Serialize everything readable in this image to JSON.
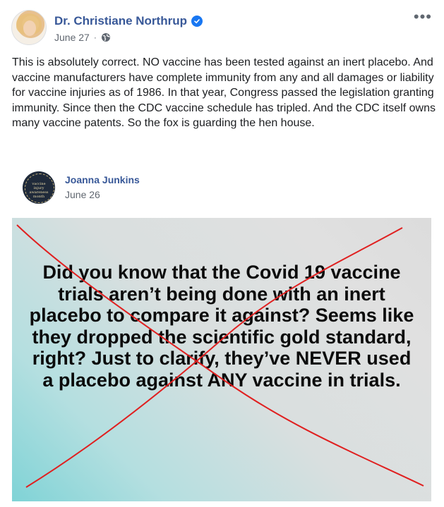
{
  "post": {
    "author": "Dr. Christiane Northrup",
    "verified_icon": "check-circle-icon",
    "date": "June 27",
    "separator": "·",
    "privacy_icon": "globe-icon",
    "more_label": "•••",
    "text": "This is absolutely correct. NO vaccine has been tested against an inert placebo. And vaccine manufacturers have complete immunity from any and all damages or liability for vaccine injuries as of 1986. In that year, Congress passed the legislation granting immunity. Since then the CDC vaccine schedule has tripled. And the CDC itself owns many vaccine patents. So the fox is guarding the hen house."
  },
  "shared": {
    "author": "Joanna Junkins",
    "date": "June 26",
    "avatar_text": "vaccine injury awareness month",
    "meme_text": "Did you know that the Covid 19 vaccine trials aren’t being done with an inert placebo to compare it against? Seems like they dropped the scientific gold standard, right? Just to clarify, they’ve NEVER used a placebo against ANY vaccine in trials."
  },
  "colors": {
    "link": "#385898",
    "meta": "#606770",
    "verified": "#1877f2",
    "cross": "#e02020"
  }
}
